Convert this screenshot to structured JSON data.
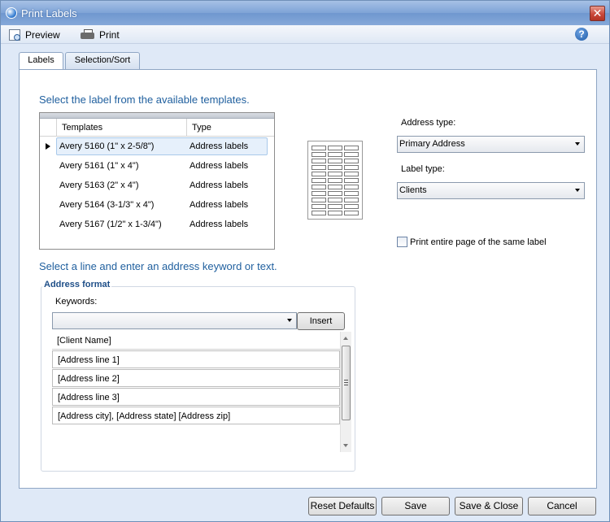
{
  "window": {
    "title": "Print Labels",
    "close_glyph": "✕"
  },
  "toolbar": {
    "preview_label": "Preview",
    "print_label": "Print",
    "help_glyph": "?"
  },
  "tabs": [
    {
      "label": "Labels",
      "selected": true
    },
    {
      "label": "Selection/Sort",
      "selected": false
    }
  ],
  "templates_section": {
    "title": "Select the label from the available templates.",
    "columns": [
      "Templates",
      "Type"
    ],
    "rows": [
      {
        "template": "Avery 5160 (1\" x 2-5/8\")",
        "type": "Address labels",
        "selected": true
      },
      {
        "template": "Avery 5161 (1\" x 4\")",
        "type": "Address labels",
        "selected": false
      },
      {
        "template": "Avery 5163 (2\" x 4\")",
        "type": "Address labels",
        "selected": false
      },
      {
        "template": "Avery 5164 (3-1/3\" x 4\")",
        "type": "Address labels",
        "selected": false
      },
      {
        "template": "Avery 5167 (1/2\" x 1-3/4\")",
        "type": "Address labels",
        "selected": false
      }
    ]
  },
  "options": {
    "address_type_label": "Address type:",
    "address_type_value": "Primary Address",
    "label_type_label": "Label type:",
    "label_type_value": "Clients",
    "print_entire_page_label": "Print entire page of the same label",
    "print_entire_page_checked": false
  },
  "address_section": {
    "title": "Select a line and enter an address keyword or text.",
    "group_title": "Address format",
    "keywords_label": "Keywords:",
    "keywords_value": "",
    "insert_label": "Insert",
    "lines": [
      "[Client Name]",
      "[Address line 1]",
      "[Address line 2]",
      "[Address line 3]",
      "[Address city], [Address state] [Address zip]"
    ]
  },
  "footer": {
    "reset_label": "Reset Defaults",
    "save_label": "Save",
    "save_close_label": "Save & Close",
    "cancel_label": "Cancel"
  }
}
